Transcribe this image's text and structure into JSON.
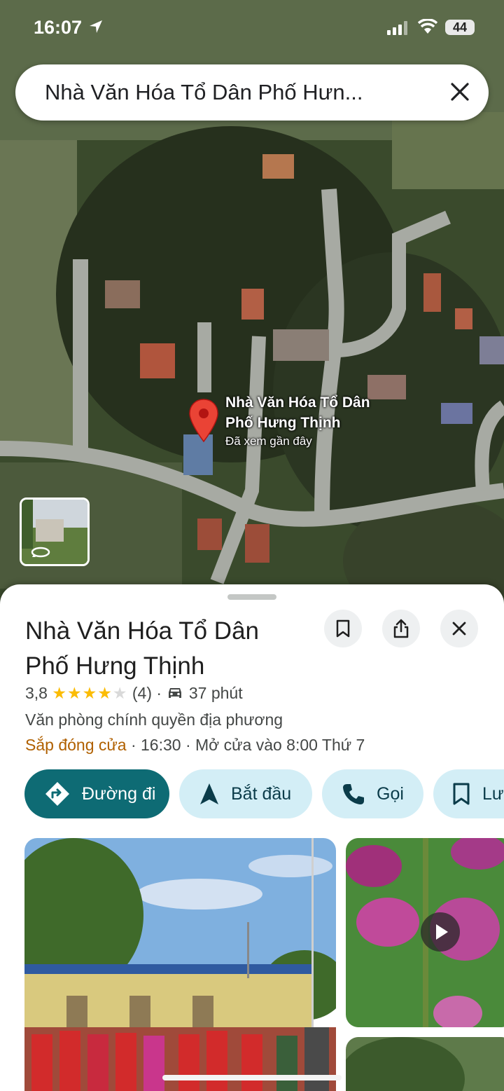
{
  "status_bar": {
    "time": "16:07",
    "battery": "44"
  },
  "search": {
    "query": "Nhà Văn Hóa Tổ Dân Phố Hưn..."
  },
  "map": {
    "pin_label_line1": "Nhà Văn Hóa Tổ Dân",
    "pin_label_line2": "Phố Hưng Thịnh",
    "pin_subtitle": "Đã xem gần đây"
  },
  "place": {
    "title_line1": "Nhà Văn Hóa Tổ Dân",
    "title_line2": "Phố Hưng Thịnh",
    "rating": "3,8",
    "rating_value": 3.8,
    "review_count": "(4)",
    "separator": "·",
    "drive_time": "37 phút",
    "category": "Văn phòng chính quyền địa phương",
    "hours_status": "Sắp đóng cửa",
    "hours_detail": "· 16:30 · Mở cửa vào 8:00 Thứ 7"
  },
  "actions": {
    "directions": "Đường đi",
    "start": "Bắt đầu",
    "call": "Gọi",
    "save": "Lư"
  },
  "colors": {
    "accent": "#0e6b74",
    "chip_bg": "#d3eef6",
    "star": "#fbbc04",
    "closing": "#b06000",
    "pin": "#ea4335"
  }
}
